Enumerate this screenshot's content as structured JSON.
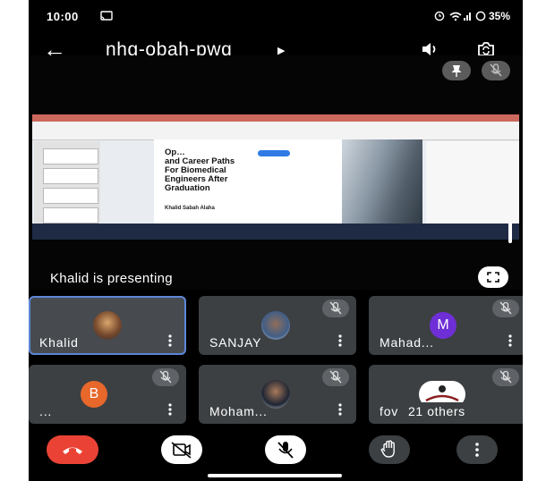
{
  "status_bar": {
    "time": "10:00",
    "right": "35%"
  },
  "meeting": {
    "code": "nhg-obah-pwq"
  },
  "slide": {
    "heading": [
      "Op…",
      "and Career Paths",
      "For Biomedical",
      "Engineers After",
      "Graduation"
    ],
    "author": "Khalid Sabah Alaha"
  },
  "presenting_label": "Khalid is presenting",
  "participants": [
    {
      "name": "Khalid",
      "kind": "photo",
      "muted": false,
      "active": true
    },
    {
      "name": "SANJAY",
      "kind": "photo",
      "muted": true,
      "active": false
    },
    {
      "name": "Mahad...",
      "kind": "letter",
      "letter": "M",
      "color": "#6f2fd6",
      "muted": true,
      "active": false
    },
    {
      "name": "...",
      "kind": "letter",
      "letter": "B",
      "color": "#e8672b",
      "muted": true,
      "active": false
    },
    {
      "name": "Moham...",
      "kind": "photo",
      "muted": true,
      "active": false
    },
    {
      "name": "fov",
      "kind": "logo",
      "overlay": "21 others",
      "muted": true,
      "active": false
    }
  ],
  "colors": {
    "end_call": "#ea4335",
    "tile": "#3c4043",
    "active_border": "#5d86d7"
  },
  "icons": {
    "end_call": "phone-hangup-icon",
    "camera": "camera-off-icon",
    "mic": "mic-off-icon",
    "raise_hand": "hand-icon",
    "more": "more-vert-icon"
  }
}
